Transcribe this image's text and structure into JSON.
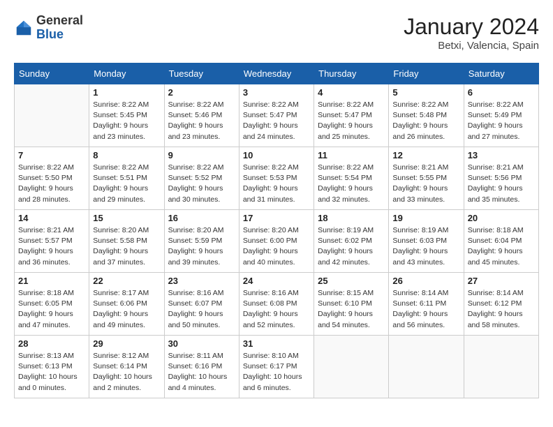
{
  "header": {
    "logo_general": "General",
    "logo_blue": "Blue",
    "month_year": "January 2024",
    "location": "Betxi, Valencia, Spain"
  },
  "days_of_week": [
    "Sunday",
    "Monday",
    "Tuesday",
    "Wednesday",
    "Thursday",
    "Friday",
    "Saturday"
  ],
  "weeks": [
    [
      {
        "day": "",
        "detail": ""
      },
      {
        "day": "1",
        "detail": "Sunrise: 8:22 AM\nSunset: 5:45 PM\nDaylight: 9 hours\nand 23 minutes."
      },
      {
        "day": "2",
        "detail": "Sunrise: 8:22 AM\nSunset: 5:46 PM\nDaylight: 9 hours\nand 23 minutes."
      },
      {
        "day": "3",
        "detail": "Sunrise: 8:22 AM\nSunset: 5:47 PM\nDaylight: 9 hours\nand 24 minutes."
      },
      {
        "day": "4",
        "detail": "Sunrise: 8:22 AM\nSunset: 5:47 PM\nDaylight: 9 hours\nand 25 minutes."
      },
      {
        "day": "5",
        "detail": "Sunrise: 8:22 AM\nSunset: 5:48 PM\nDaylight: 9 hours\nand 26 minutes."
      },
      {
        "day": "6",
        "detail": "Sunrise: 8:22 AM\nSunset: 5:49 PM\nDaylight: 9 hours\nand 27 minutes."
      }
    ],
    [
      {
        "day": "7",
        "detail": "Sunrise: 8:22 AM\nSunset: 5:50 PM\nDaylight: 9 hours\nand 28 minutes."
      },
      {
        "day": "8",
        "detail": "Sunrise: 8:22 AM\nSunset: 5:51 PM\nDaylight: 9 hours\nand 29 minutes."
      },
      {
        "day": "9",
        "detail": "Sunrise: 8:22 AM\nSunset: 5:52 PM\nDaylight: 9 hours\nand 30 minutes."
      },
      {
        "day": "10",
        "detail": "Sunrise: 8:22 AM\nSunset: 5:53 PM\nDaylight: 9 hours\nand 31 minutes."
      },
      {
        "day": "11",
        "detail": "Sunrise: 8:22 AM\nSunset: 5:54 PM\nDaylight: 9 hours\nand 32 minutes."
      },
      {
        "day": "12",
        "detail": "Sunrise: 8:21 AM\nSunset: 5:55 PM\nDaylight: 9 hours\nand 33 minutes."
      },
      {
        "day": "13",
        "detail": "Sunrise: 8:21 AM\nSunset: 5:56 PM\nDaylight: 9 hours\nand 35 minutes."
      }
    ],
    [
      {
        "day": "14",
        "detail": "Sunrise: 8:21 AM\nSunset: 5:57 PM\nDaylight: 9 hours\nand 36 minutes."
      },
      {
        "day": "15",
        "detail": "Sunrise: 8:20 AM\nSunset: 5:58 PM\nDaylight: 9 hours\nand 37 minutes."
      },
      {
        "day": "16",
        "detail": "Sunrise: 8:20 AM\nSunset: 5:59 PM\nDaylight: 9 hours\nand 39 minutes."
      },
      {
        "day": "17",
        "detail": "Sunrise: 8:20 AM\nSunset: 6:00 PM\nDaylight: 9 hours\nand 40 minutes."
      },
      {
        "day": "18",
        "detail": "Sunrise: 8:19 AM\nSunset: 6:02 PM\nDaylight: 9 hours\nand 42 minutes."
      },
      {
        "day": "19",
        "detail": "Sunrise: 8:19 AM\nSunset: 6:03 PM\nDaylight: 9 hours\nand 43 minutes."
      },
      {
        "day": "20",
        "detail": "Sunrise: 8:18 AM\nSunset: 6:04 PM\nDaylight: 9 hours\nand 45 minutes."
      }
    ],
    [
      {
        "day": "21",
        "detail": "Sunrise: 8:18 AM\nSunset: 6:05 PM\nDaylight: 9 hours\nand 47 minutes."
      },
      {
        "day": "22",
        "detail": "Sunrise: 8:17 AM\nSunset: 6:06 PM\nDaylight: 9 hours\nand 49 minutes."
      },
      {
        "day": "23",
        "detail": "Sunrise: 8:16 AM\nSunset: 6:07 PM\nDaylight: 9 hours\nand 50 minutes."
      },
      {
        "day": "24",
        "detail": "Sunrise: 8:16 AM\nSunset: 6:08 PM\nDaylight: 9 hours\nand 52 minutes."
      },
      {
        "day": "25",
        "detail": "Sunrise: 8:15 AM\nSunset: 6:10 PM\nDaylight: 9 hours\nand 54 minutes."
      },
      {
        "day": "26",
        "detail": "Sunrise: 8:14 AM\nSunset: 6:11 PM\nDaylight: 9 hours\nand 56 minutes."
      },
      {
        "day": "27",
        "detail": "Sunrise: 8:14 AM\nSunset: 6:12 PM\nDaylight: 9 hours\nand 58 minutes."
      }
    ],
    [
      {
        "day": "28",
        "detail": "Sunrise: 8:13 AM\nSunset: 6:13 PM\nDaylight: 10 hours\nand 0 minutes."
      },
      {
        "day": "29",
        "detail": "Sunrise: 8:12 AM\nSunset: 6:14 PM\nDaylight: 10 hours\nand 2 minutes."
      },
      {
        "day": "30",
        "detail": "Sunrise: 8:11 AM\nSunset: 6:16 PM\nDaylight: 10 hours\nand 4 minutes."
      },
      {
        "day": "31",
        "detail": "Sunrise: 8:10 AM\nSunset: 6:17 PM\nDaylight: 10 hours\nand 6 minutes."
      },
      {
        "day": "",
        "detail": ""
      },
      {
        "day": "",
        "detail": ""
      },
      {
        "day": "",
        "detail": ""
      }
    ]
  ]
}
